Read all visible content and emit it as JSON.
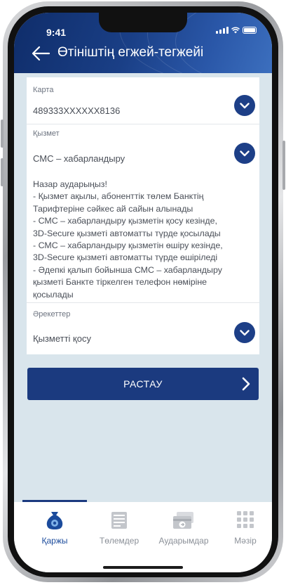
{
  "status_bar": {
    "time": "9:41"
  },
  "header": {
    "title": "Өтініштің егжей-тегжейі"
  },
  "form": {
    "card_field": {
      "label": "Карта",
      "value": "489333XXXXXX8136"
    },
    "service_field": {
      "label": "Қызмет",
      "value": "СМС – хабарландыру"
    },
    "notice_lines": [
      "Назар аударыңыз!",
      " - Қызмет ақылы, абоненттік төлем Банктің",
      "Тарифтеріне сәйкес ай сайын алынады",
      " - СМС – хабарландыру қызметін қосу кезінде,",
      "3D-Secure қызметі автоматты түрде қосылады",
      " - СМС – хабарландыру қызметін өшіру кезінде,",
      "3D-Secure қызметі автоматты түрде өшіріледі",
      " - Әдепкі қалып бойынша СМС – хабарландыру",
      "қызметі Банкте тіркелген телефон нөміріне",
      "қосылады"
    ],
    "action_field": {
      "label": "Әрекеттер",
      "value": "Қызметті қосу"
    }
  },
  "confirm_button": {
    "label": "РАСТАУ"
  },
  "bottom_nav": {
    "items": [
      {
        "label": "Қаржы",
        "icon": "money-bag-icon",
        "active": true
      },
      {
        "label": "Төлемдер",
        "icon": "payments-icon",
        "active": false
      },
      {
        "label": "Аударымдар",
        "icon": "transfer-card-icon",
        "active": false
      },
      {
        "label": "Мәзір",
        "icon": "grid-menu-icon",
        "active": false
      }
    ]
  },
  "colors": {
    "header_start": "#0f2d6a",
    "header_end": "#3c6fbe",
    "accent": "#1b3a7f",
    "screen_bg": "#d9e5ec",
    "active_tab": "#1b4b9c"
  }
}
